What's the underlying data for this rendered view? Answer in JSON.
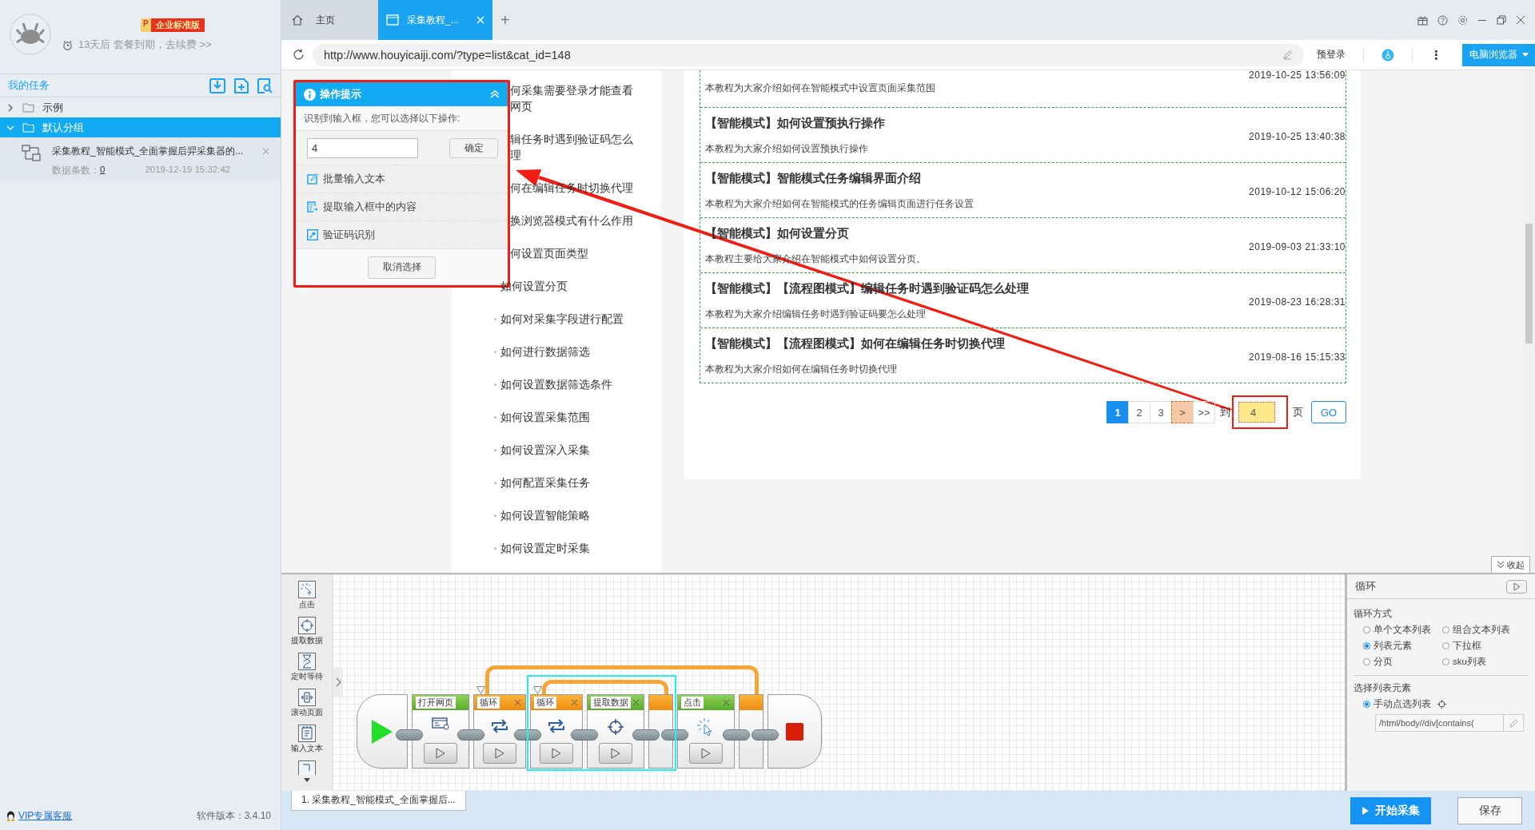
{
  "sidebar": {
    "badge_letter": "P",
    "badge": "企业标准版",
    "expiry": "13天后 套餐到期，去续费 >>",
    "tasks_title": "我的任务",
    "tree": [
      {
        "label": "示例",
        "expanded": false,
        "selected": false
      },
      {
        "label": "默认分组",
        "expanded": true,
        "selected": true,
        "children": [
          {
            "title": "采集教程_智能模式_全面掌握后羿采集器的...",
            "count_label": "数据条数：",
            "count": "0",
            "date": "2019-12-19 15:32:42"
          }
        ]
      }
    ],
    "support": "VIP专属客服",
    "version": "软件版本：3.4.10"
  },
  "browser": {
    "tabs": [
      {
        "kind": "home",
        "label": "主页",
        "selected": false
      },
      {
        "kind": "page",
        "label": "采集教程_...",
        "selected": true
      }
    ],
    "new_tab": "+",
    "url": "http://www.houyicaiji.com/?type=list&cat_id=148",
    "pre_login": "预登录",
    "menu": "⋮",
    "mode": "电脑浏览器"
  },
  "page": {
    "topics": [
      {
        "kind": "covered",
        "label": "何采集需要登录才能查看网页"
      },
      {
        "kind": "covered",
        "label": "辑任务时遇到验证码怎么理"
      },
      {
        "kind": "covered",
        "label": "何在编辑任务时切换代理"
      },
      {
        "kind": "covered",
        "label": "换浏览器模式有什么作用"
      },
      {
        "kind": "covered",
        "label": "何设置页面类型"
      },
      {
        "kind": "item",
        "label": "如何设置分页"
      },
      {
        "kind": "item",
        "label": "如何对采集字段进行配置"
      },
      {
        "kind": "item",
        "label": "如何进行数据筛选"
      },
      {
        "kind": "item",
        "label": "如何设置数据筛选条件"
      },
      {
        "kind": "item",
        "label": "如何设置采集范围"
      },
      {
        "kind": "item",
        "label": "如何设置深入采集"
      },
      {
        "kind": "item",
        "label": "如何配置采集任务"
      },
      {
        "kind": "item",
        "label": "如何设置智能策略"
      },
      {
        "kind": "item",
        "label": "如何设置定时采集"
      }
    ],
    "articles": [
      {
        "kind": "partial",
        "date": "2019-10-25 13:56:09",
        "desc": "本教程为大家介绍如何在智能模式中设置页面采集范围"
      },
      {
        "kind": "full",
        "title": "【智能模式】如何设置预执行操作",
        "date": "2019-10-25 13:40:38",
        "desc": "本教程为大家介绍如何设置预执行操作"
      },
      {
        "kind": "full",
        "title": "【智能模式】智能模式任务编辑界面介绍",
        "date": "2019-10-12 15:06:20",
        "desc": "本教程为大家介绍如何在智能模式的任务编辑页面进行任务设置"
      },
      {
        "kind": "full",
        "title": "【智能模式】如何设置分页",
        "date": "2019-09-03 21:33:10",
        "desc": "本教程主要给大家介绍在智能模式中如何设置分页。"
      },
      {
        "kind": "full",
        "title": "【智能模式】【流程图模式】编辑任务时遇到验证码怎么处理",
        "date": "2019-08-23 16:28:31",
        "desc": "本教程为大家介绍编辑任务时遇到验证码要怎么处理"
      },
      {
        "kind": "full",
        "title": "【智能模式】【流程图模式】如何在编辑任务时切换代理",
        "date": "2019-08-16 15:15:33",
        "desc": "本教程为大家介绍如何在编辑任务时切换代理"
      }
    ],
    "pagination": {
      "pages": [
        {
          "label": "1",
          "selected": true
        },
        {
          "label": "2",
          "selected": false
        },
        {
          "label": "3",
          "selected": false
        }
      ],
      "next": ">",
      "next_highlighted": true,
      "last": ">>",
      "goto_label": "到",
      "page_input": "4",
      "page_input_highlighted": true,
      "unit": "页",
      "go": "GO"
    }
  },
  "popup": {
    "title": "操作提示",
    "hint": "识别到输入框，您可以选择以下操作:",
    "input_value": "4",
    "confirm": "确定",
    "options": [
      "批量输入文本",
      "提取输入框中的内容",
      "验证码识别"
    ],
    "cancel": "取消选择"
  },
  "collapse": "收起",
  "workflow": {
    "tools": [
      {
        "kind": "click",
        "label": "点击"
      },
      {
        "kind": "extract",
        "label": "提取数据"
      },
      {
        "kind": "wait",
        "label": "定时等待"
      },
      {
        "kind": "scroll",
        "label": "滚动页面"
      },
      {
        "kind": "input",
        "label": "输入文本"
      }
    ],
    "steps": [
      {
        "kind": "start"
      },
      {
        "kind": "open_page",
        "label": "打开网页",
        "removable": false
      },
      {
        "kind": "loop",
        "label": "循环",
        "removable": true,
        "selected": false,
        "children": [
          {
            "kind": "loop",
            "label": "循环",
            "removable": true,
            "selected": true,
            "children": [
              {
                "kind": "extract",
                "label": "提取数据",
                "removable": true
              }
            ]
          },
          {
            "kind": "click",
            "label": "点击",
            "removable": true
          }
        ]
      },
      {
        "kind": "stop"
      }
    ]
  },
  "properties": {
    "title": "循环",
    "mode_label": "循环方式",
    "modes": [
      {
        "label": "单个文本列表",
        "selected": false
      },
      {
        "label": "组合文本列表",
        "selected": false
      },
      {
        "label": "列表元素",
        "selected": true
      },
      {
        "label": "下拉框",
        "selected": false
      },
      {
        "label": "分页",
        "selected": false
      },
      {
        "label": "sku列表",
        "selected": false
      }
    ],
    "list_label": "选择列表元素",
    "manual": {
      "label": "手动点选列表",
      "selected": true
    },
    "xpath": "/html/body//div[contains("
  },
  "bottom": {
    "task_tab": "1. 采集教程_智能模式_全面掌握后...",
    "start": "开始采集",
    "save": "保存"
  }
}
